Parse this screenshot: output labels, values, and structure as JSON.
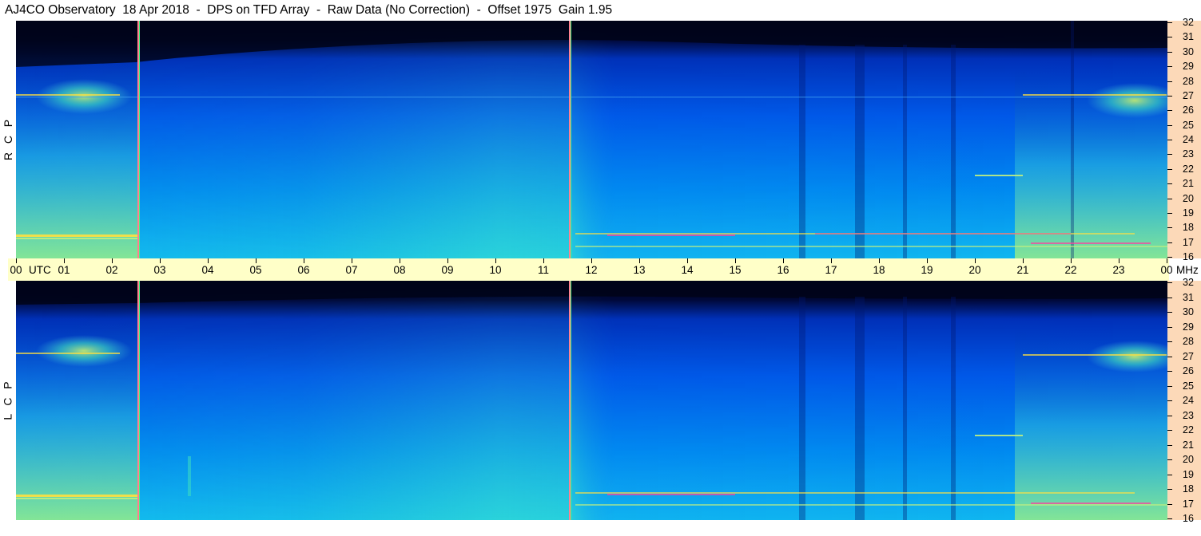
{
  "title": "AJ4CO Observatory  18 Apr 2018  -  DPS on TFD Array  -  Raw Data (No Correction)  -  Offset 1975  Gain 1.95",
  "panels": [
    {
      "id": "rcp",
      "label": "R  C  P"
    },
    {
      "id": "lcp",
      "label": "L  C  P"
    }
  ],
  "time_axis": {
    "labels": [
      "00",
      "01",
      "02",
      "03",
      "04",
      "05",
      "06",
      "07",
      "08",
      "09",
      "10",
      "11",
      "12",
      "13",
      "14",
      "15",
      "16",
      "17",
      "18",
      "19",
      "20",
      "21",
      "22",
      "23",
      "00"
    ],
    "utc_label": "UTC",
    "unit_label": "MHz"
  },
  "freq_axis": {
    "ticks_mhz": [
      32,
      31,
      30,
      29,
      28,
      27,
      26,
      25,
      24,
      23,
      22,
      21,
      20,
      19,
      18,
      17,
      16
    ]
  },
  "markers_utc_hours": [
    2.55,
    11.55
  ],
  "colors": {
    "axis_band": "#ffffc8",
    "freq_band": "#fcd9b8",
    "colormap": [
      "#000018",
      "#001060",
      "#0038d8",
      "#0070f0",
      "#00b0e8",
      "#30e0c8",
      "#c0f080",
      "#ffe040"
    ],
    "marker_line": "#ff8090"
  },
  "icons": {
    "spectrogram": "waterfall-spectrogram"
  }
}
